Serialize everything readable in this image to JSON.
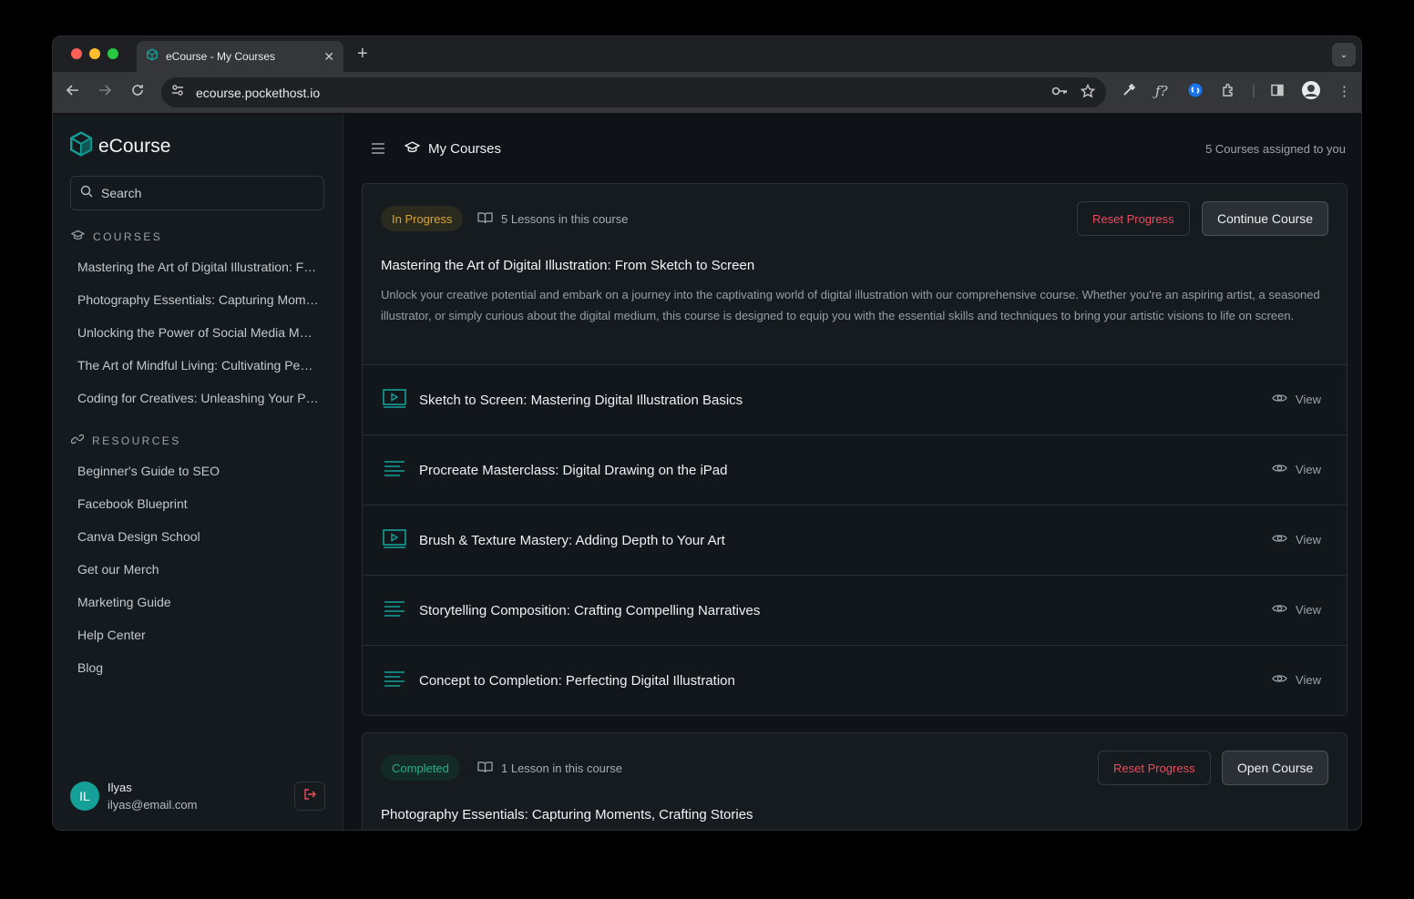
{
  "browser": {
    "tab_title": "eCourse - My Courses",
    "url": "ecourse.pockethost.io"
  },
  "sidebar": {
    "brand": "eCourse",
    "search_placeholder": "Search",
    "courses_heading": "COURSES",
    "courses": [
      "Mastering the Art of Digital Illustration: From Sketch to Screen",
      "Photography Essentials: Capturing Moments, Crafting Stories",
      "Unlocking the Power of Social Media Marketing",
      "The Art of Mindful Living: Cultivating Peace",
      "Coding for Creatives: Unleashing Your Potential"
    ],
    "resources_heading": "RESOURCES",
    "resources": [
      "Beginner's Guide to SEO",
      "Facebook Blueprint",
      "Canva Design School",
      "Get our Merch",
      "Marketing Guide",
      "Help Center",
      "Blog"
    ],
    "user": {
      "initials": "IL",
      "name": "Ilyas",
      "email": "ilyas@email.com"
    }
  },
  "header": {
    "title": "My Courses",
    "count": "5 Courses assigned to you"
  },
  "courses": [
    {
      "status": "In Progress",
      "lessons_info": "5 Lessons in this course",
      "reset_label": "Reset Progress",
      "action_label": "Continue Course",
      "title": "Mastering the Art of Digital Illustration: From Sketch to Screen",
      "description": "Unlock your creative potential and embark on a journey into the captivating world of digital illustration with our comprehensive course. Whether you're an aspiring artist, a seasoned illustrator, or simply curious about the digital medium, this course is designed to equip you with the essential skills and techniques to bring your artistic visions to life on screen.",
      "lessons": [
        {
          "type": "video",
          "title": "Sketch to Screen: Mastering Digital Illustration Basics",
          "action": "View"
        },
        {
          "type": "text",
          "title": "Procreate Masterclass: Digital Drawing on the iPad",
          "action": "View"
        },
        {
          "type": "video",
          "title": "Brush & Texture Mastery: Adding Depth to Your Art",
          "action": "View"
        },
        {
          "type": "text",
          "title": "Storytelling Composition: Crafting Compelling Narratives",
          "action": "View"
        },
        {
          "type": "text",
          "title": "Concept to Completion: Perfecting Digital Illustration",
          "action": "View"
        }
      ]
    },
    {
      "status": "Completed",
      "lessons_info": "1 Lesson in this course",
      "reset_label": "Reset Progress",
      "action_label": "Open Course",
      "title": "Photography Essentials: Capturing Moments, Crafting Stories"
    }
  ],
  "colors": {
    "accent": "#14a098",
    "in_progress": "#d9a534",
    "completed": "#23b08d",
    "danger": "#ea4d5d"
  }
}
